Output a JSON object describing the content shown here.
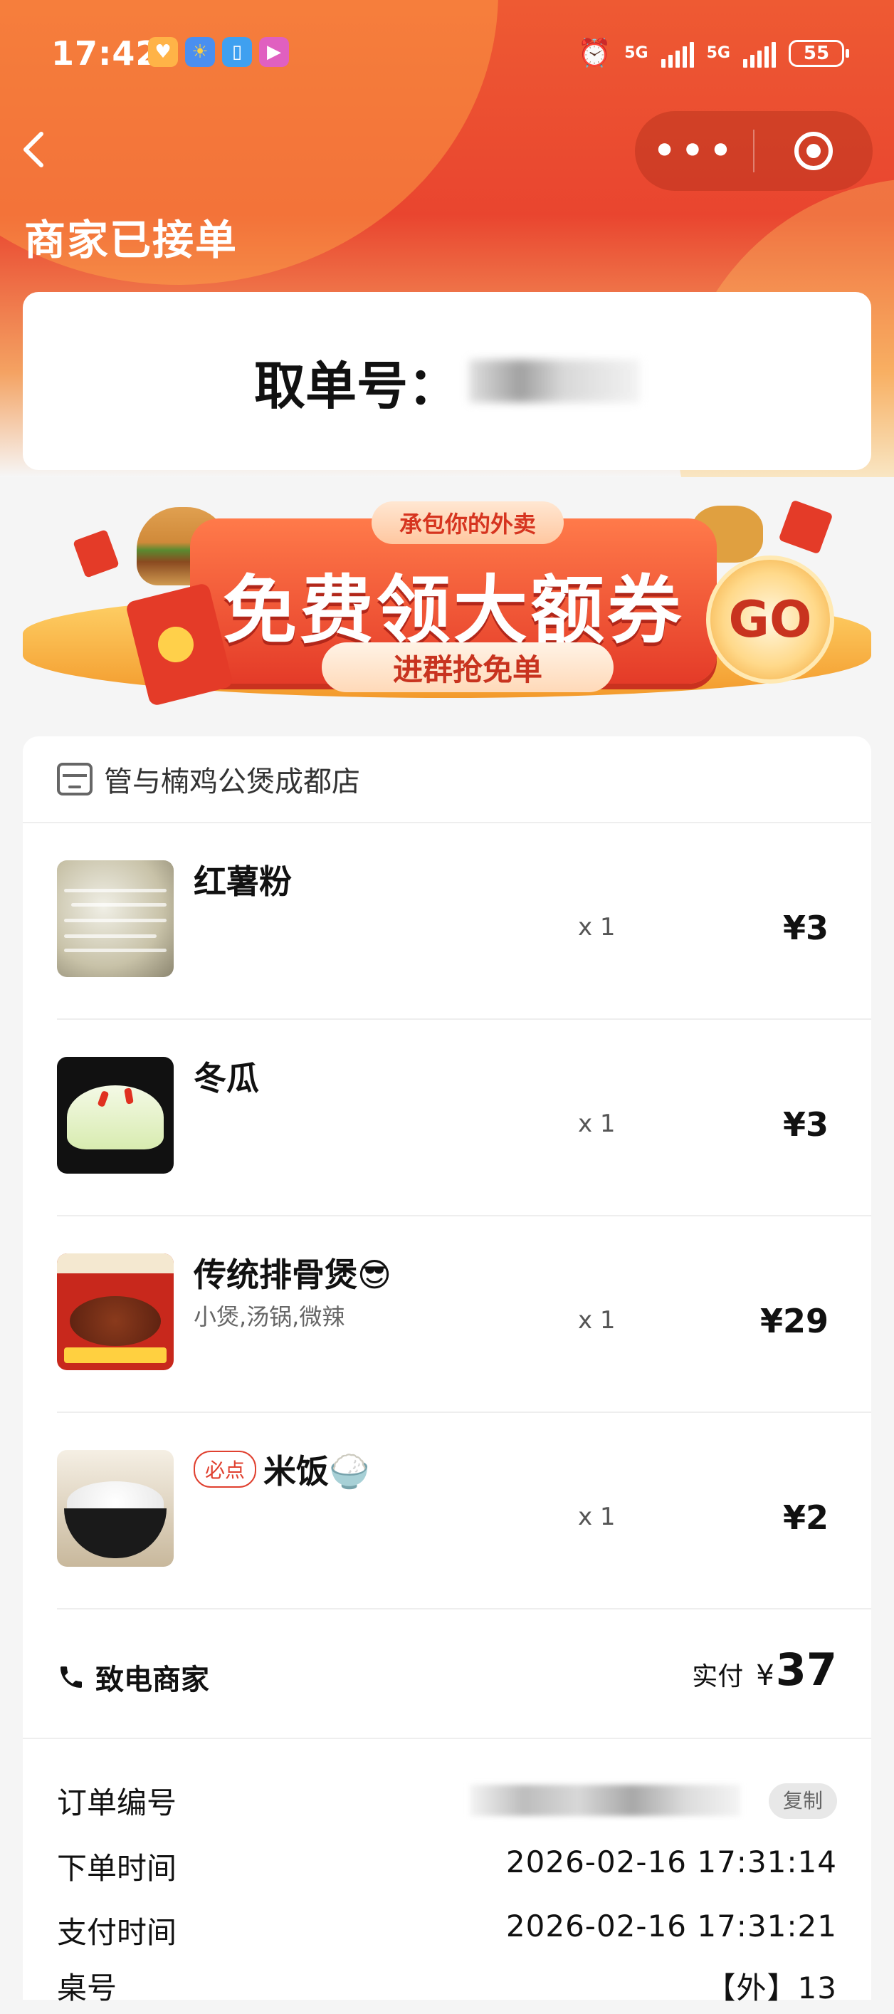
{
  "status_bar": {
    "time": "17:42",
    "network1": "5G",
    "network2": "5G",
    "battery": "55"
  },
  "nav": {
    "back_icon": "chevron-left-icon",
    "more_icon": "more-dots-icon",
    "close_icon": "target-circle-icon",
    "title": "商家已接单"
  },
  "pickup": {
    "label": "取单号："
  },
  "banner": {
    "tag": "承包你的外卖",
    "headline": "免费领大额券",
    "sub": "进群抢免单",
    "go": "GO"
  },
  "shop": {
    "name": "管与楠鸡公煲成都店"
  },
  "items": [
    {
      "name": "红薯粉",
      "options": "",
      "qty": "x 1",
      "price": "¥3",
      "badge": ""
    },
    {
      "name": "冬瓜",
      "options": "",
      "qty": "x 1",
      "price": "¥3",
      "badge": ""
    },
    {
      "name": "传统排骨煲😎",
      "options": "小煲,汤锅,微辣",
      "qty": "x 1",
      "price": "¥29",
      "badge": ""
    },
    {
      "name": "米饭🍚",
      "options": "",
      "qty": "x 1",
      "price": "¥2",
      "badge": "必点"
    }
  ],
  "footer": {
    "call_label": "致电商家",
    "paid_label": "实付",
    "currency": "¥",
    "paid_amount": "37"
  },
  "info": {
    "order_no_label": "订单编号",
    "copy_label": "复制",
    "order_time_label": "下单时间",
    "order_time": "2026-02-16 17:31:14",
    "pay_time_label": "支付时间",
    "pay_time": "2026-02-16 17:31:21",
    "table_label": "桌号",
    "table_value": "【外】13"
  }
}
